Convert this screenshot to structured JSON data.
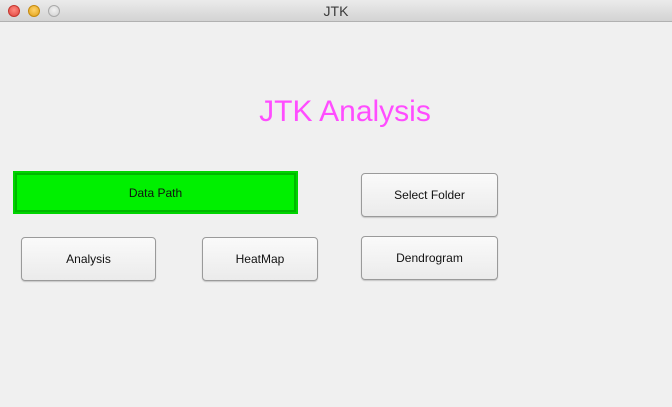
{
  "window": {
    "title": "JTK"
  },
  "main": {
    "heading": "JTK Analysis",
    "data_path_label": "Data Path",
    "buttons": {
      "analysis": "Analysis",
      "heatmap": "HeatMap",
      "select_folder": "Select Folder",
      "dendrogram": "Dendrogram"
    }
  },
  "colors": {
    "heading": "#ff4dff",
    "data_path_bg": "#00f000",
    "window_bg": "#f0f0f0"
  }
}
